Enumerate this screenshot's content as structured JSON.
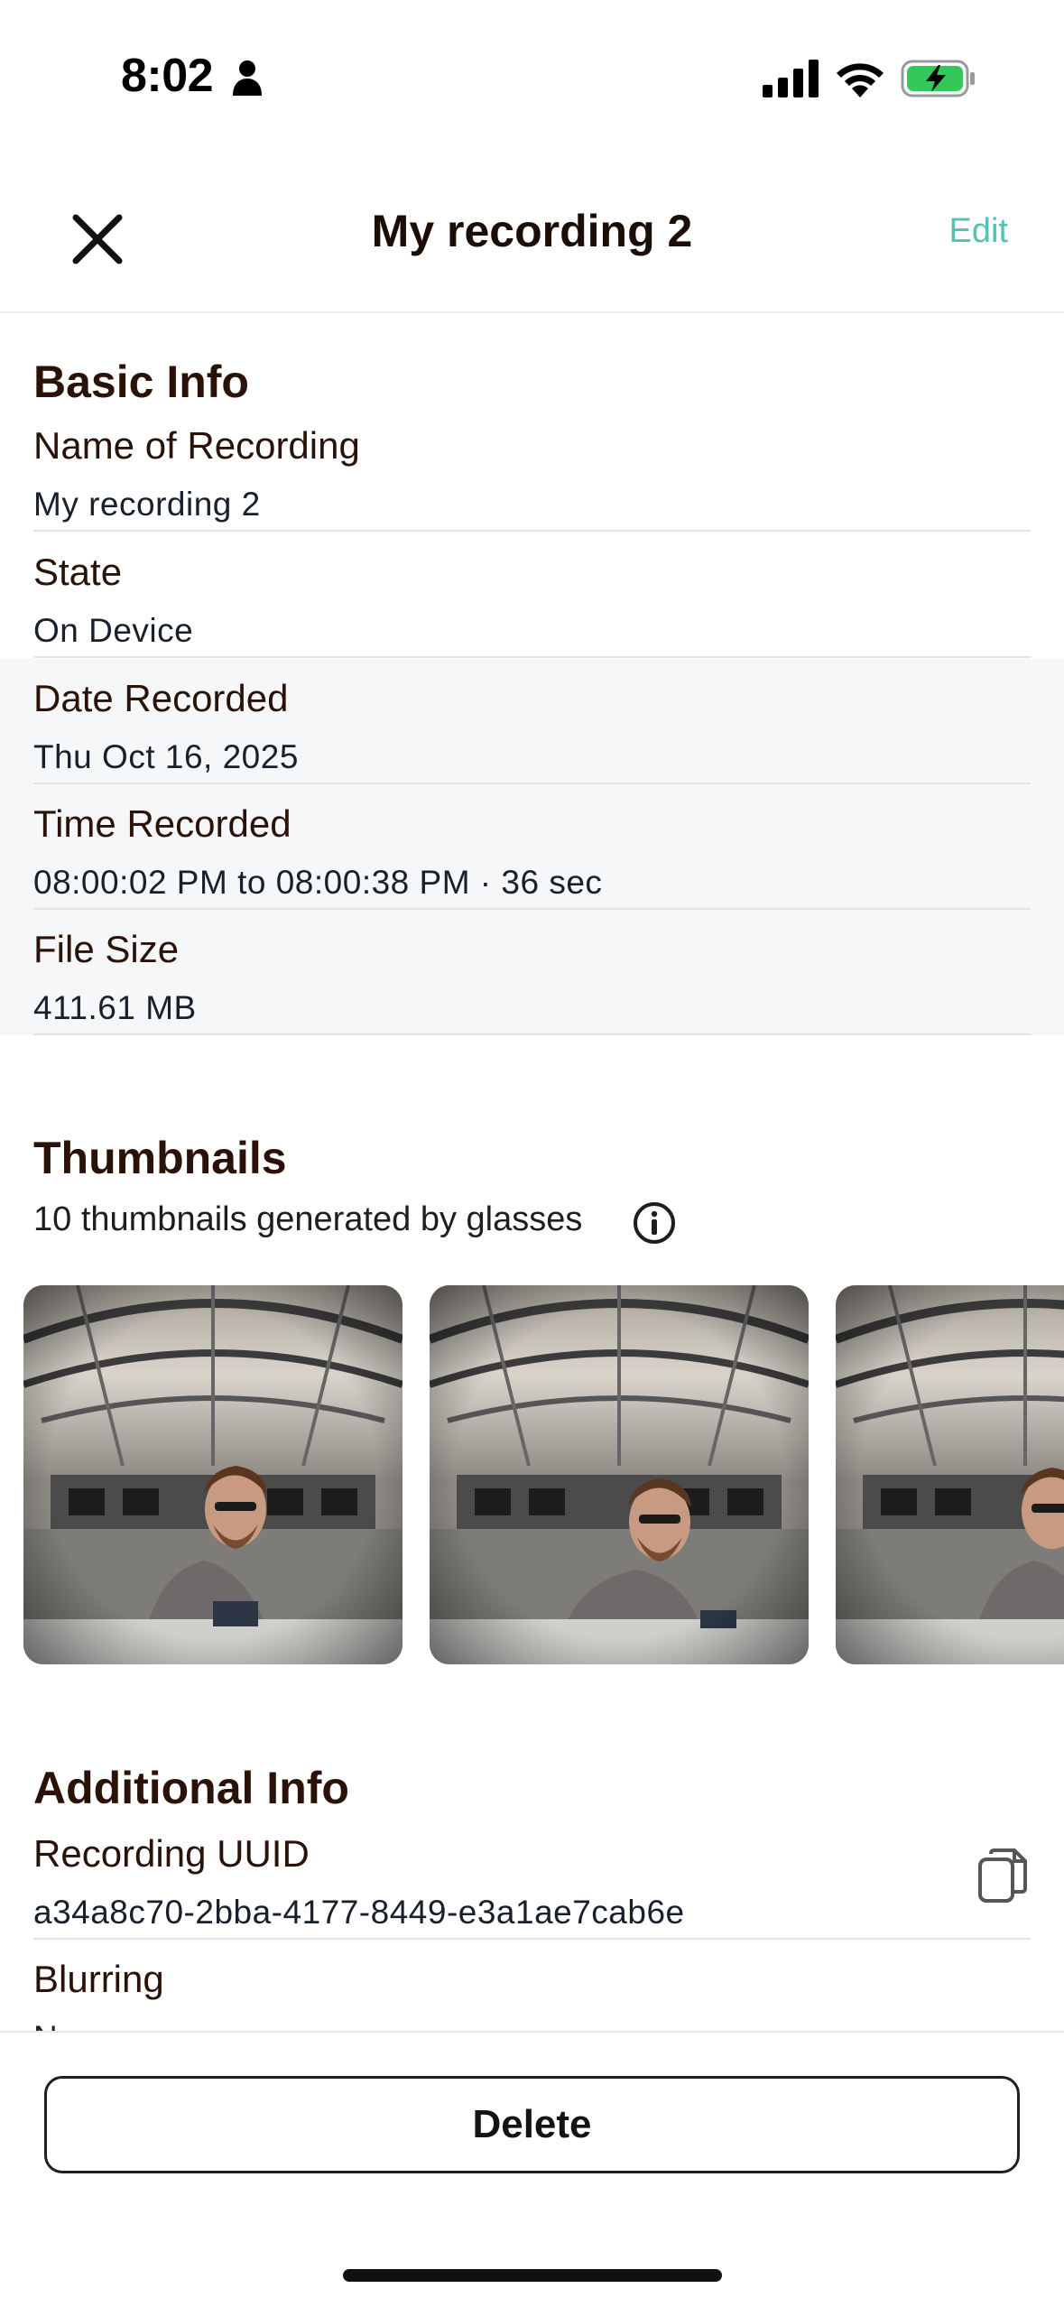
{
  "status_bar": {
    "time": "8:02"
  },
  "nav": {
    "title": "My recording 2",
    "edit_label": "Edit"
  },
  "basic_info": {
    "heading": "Basic Info",
    "rows": [
      {
        "label": "Name of Recording",
        "value": "My recording 2"
      },
      {
        "label": "State",
        "value": "On Device"
      },
      {
        "label": "Date Recorded",
        "value": "Thu Oct 16, 2025"
      },
      {
        "label": "Time Recorded",
        "value": "08:00:02 PM to 08:00:38 PM  ·  36 sec"
      },
      {
        "label": "File Size",
        "value": "411.61 MB"
      }
    ]
  },
  "thumbnails": {
    "heading": "Thumbnails",
    "subtitle": "10 thumbnails generated by glasses"
  },
  "additional_info": {
    "heading": "Additional Info",
    "rows": [
      {
        "label": "Recording UUID",
        "value": "a34a8c70-2bba-4177-8449-e3a1ae7cab6e"
      },
      {
        "label": "Blurring",
        "value": "No"
      }
    ]
  },
  "footer": {
    "delete_label": "Delete"
  },
  "colors": {
    "accent": "#52c2b3",
    "heading": "#2a1208",
    "shaded_row": "#f5f7f9"
  },
  "icons": [
    "person-icon",
    "signal-icon",
    "wifi-icon",
    "battery-charging-icon",
    "close-icon",
    "info-icon",
    "copy-icon"
  ]
}
